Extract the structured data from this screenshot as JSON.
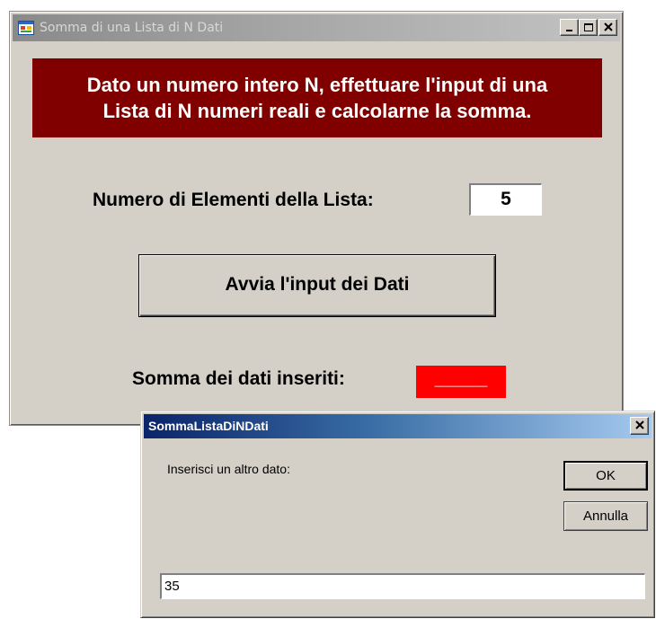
{
  "main_window": {
    "title": "Somma di una Lista di N Dati",
    "banner_line1": "Dato un numero intero N, effettuare l'input di una",
    "banner_line2": "Lista di N numeri reali e calcolarne la somma.",
    "count_label": "Numero di Elementi della Lista:",
    "count_value": "5",
    "start_button_label": "Avvia l'input dei Dati",
    "sum_label": "Somma dei dati inseriti:",
    "sum_value": "_____",
    "banner_color": "#800000",
    "sum_color": "#ff0000"
  },
  "input_dialog": {
    "title": "SommaListaDiNDati",
    "prompt": "Inserisci un altro dato:",
    "ok_label": "OK",
    "cancel_label": "Annulla",
    "input_value": "35",
    "title_color": "#0a246a"
  },
  "icons": {
    "app": "application-icon",
    "minimize": "minimize-icon",
    "maximize": "maximize-icon",
    "close": "close-icon"
  }
}
